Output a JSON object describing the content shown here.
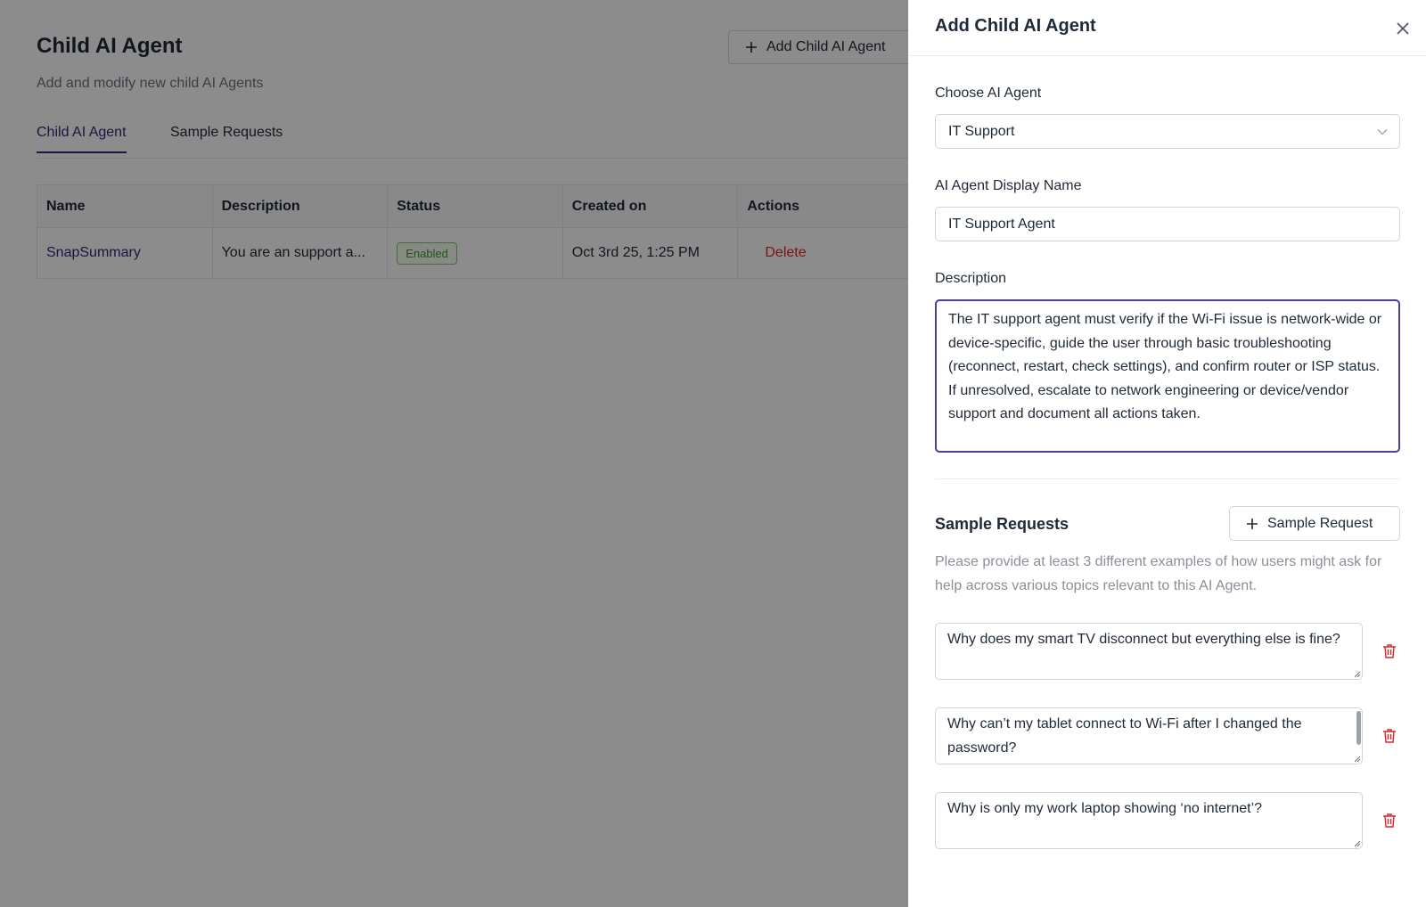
{
  "page": {
    "title": "Child AI Agent",
    "subtitle": "Add and modify new child AI Agents",
    "add_button_label": "Add Child AI Agent",
    "tabs": [
      {
        "label": "Child AI Agent",
        "active": true
      },
      {
        "label": "Sample Requests",
        "active": false
      }
    ],
    "table": {
      "columns": [
        "Name",
        "Description",
        "Status",
        "Created on",
        "Actions"
      ],
      "rows": [
        {
          "name": "SnapSummary",
          "description": "You are an support a...",
          "status": "Enabled",
          "created_on": "Oct 3rd 25, 1:25 PM",
          "action": "Delete"
        }
      ]
    }
  },
  "drawer": {
    "title": "Add Child AI Agent",
    "choose_agent": {
      "label": "Choose AI Agent",
      "selected": "IT Support"
    },
    "display_name": {
      "label": "AI Agent Display Name",
      "value": "IT Support Agent"
    },
    "description": {
      "label": "Description",
      "value": "The IT support agent must verify if the Wi-Fi issue is network-wide or device-specific, guide the user through basic troubleshooting (reconnect, restart, check settings), and confirm router or ISP status. If unresolved, escalate to network engineering or device/vendor support and document all actions taken."
    },
    "sample_requests": {
      "title": "Sample Requests",
      "add_button_label": "Sample Request",
      "help_text": "Please provide at least 3 different examples of how users might ask for help across various topics relevant to this AI Agent.",
      "items": [
        "Why does my smart TV disconnect but everything else is fine?",
        "Why can’t my tablet connect to Wi-Fi after I changed the password?",
        "Why is only my work laptop showing ‘no internet’?"
      ]
    }
  },
  "colors": {
    "accent": "#2e2a7a",
    "focus_border": "#4b3f9a",
    "danger": "#dc2626",
    "success": "#3d9a2d",
    "overlay": "rgba(0,0,0,0.45)"
  }
}
